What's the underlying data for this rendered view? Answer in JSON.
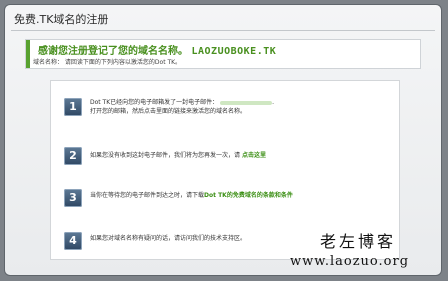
{
  "window": {
    "title": "免费.TK域名的注册"
  },
  "thanks": {
    "message": "感谢您注册登记了您的域名名称。",
    "domain": "LAOZUOBOKE.TK",
    "note": "域名名称： 请回读下面的下列内容以激活您的Dot TK。"
  },
  "steps": [
    {
      "number": "1",
      "line1_prefix": "Dot TK已经向您的电子邮箱发了一封电子邮件：",
      "line1_suffix": ".",
      "line2": "打开您的邮箱，然后点击里面的链接来激活您的域名名称。"
    },
    {
      "number": "2",
      "text": "如果您没有收到这封电子邮件，我们将为您再发一次，请",
      "link": "点击这里"
    },
    {
      "number": "3",
      "text": "当你在等待您的电子邮件到达之时，请下载",
      "link": "Dot TK的免费域名的条款和条件"
    },
    {
      "number": "4",
      "text": "如果您对域名名称有疑问的话，请访问我们的技术支持区。"
    }
  ],
  "watermark": {
    "chinese": "老左博客",
    "url": "www.laozuo.org"
  }
}
